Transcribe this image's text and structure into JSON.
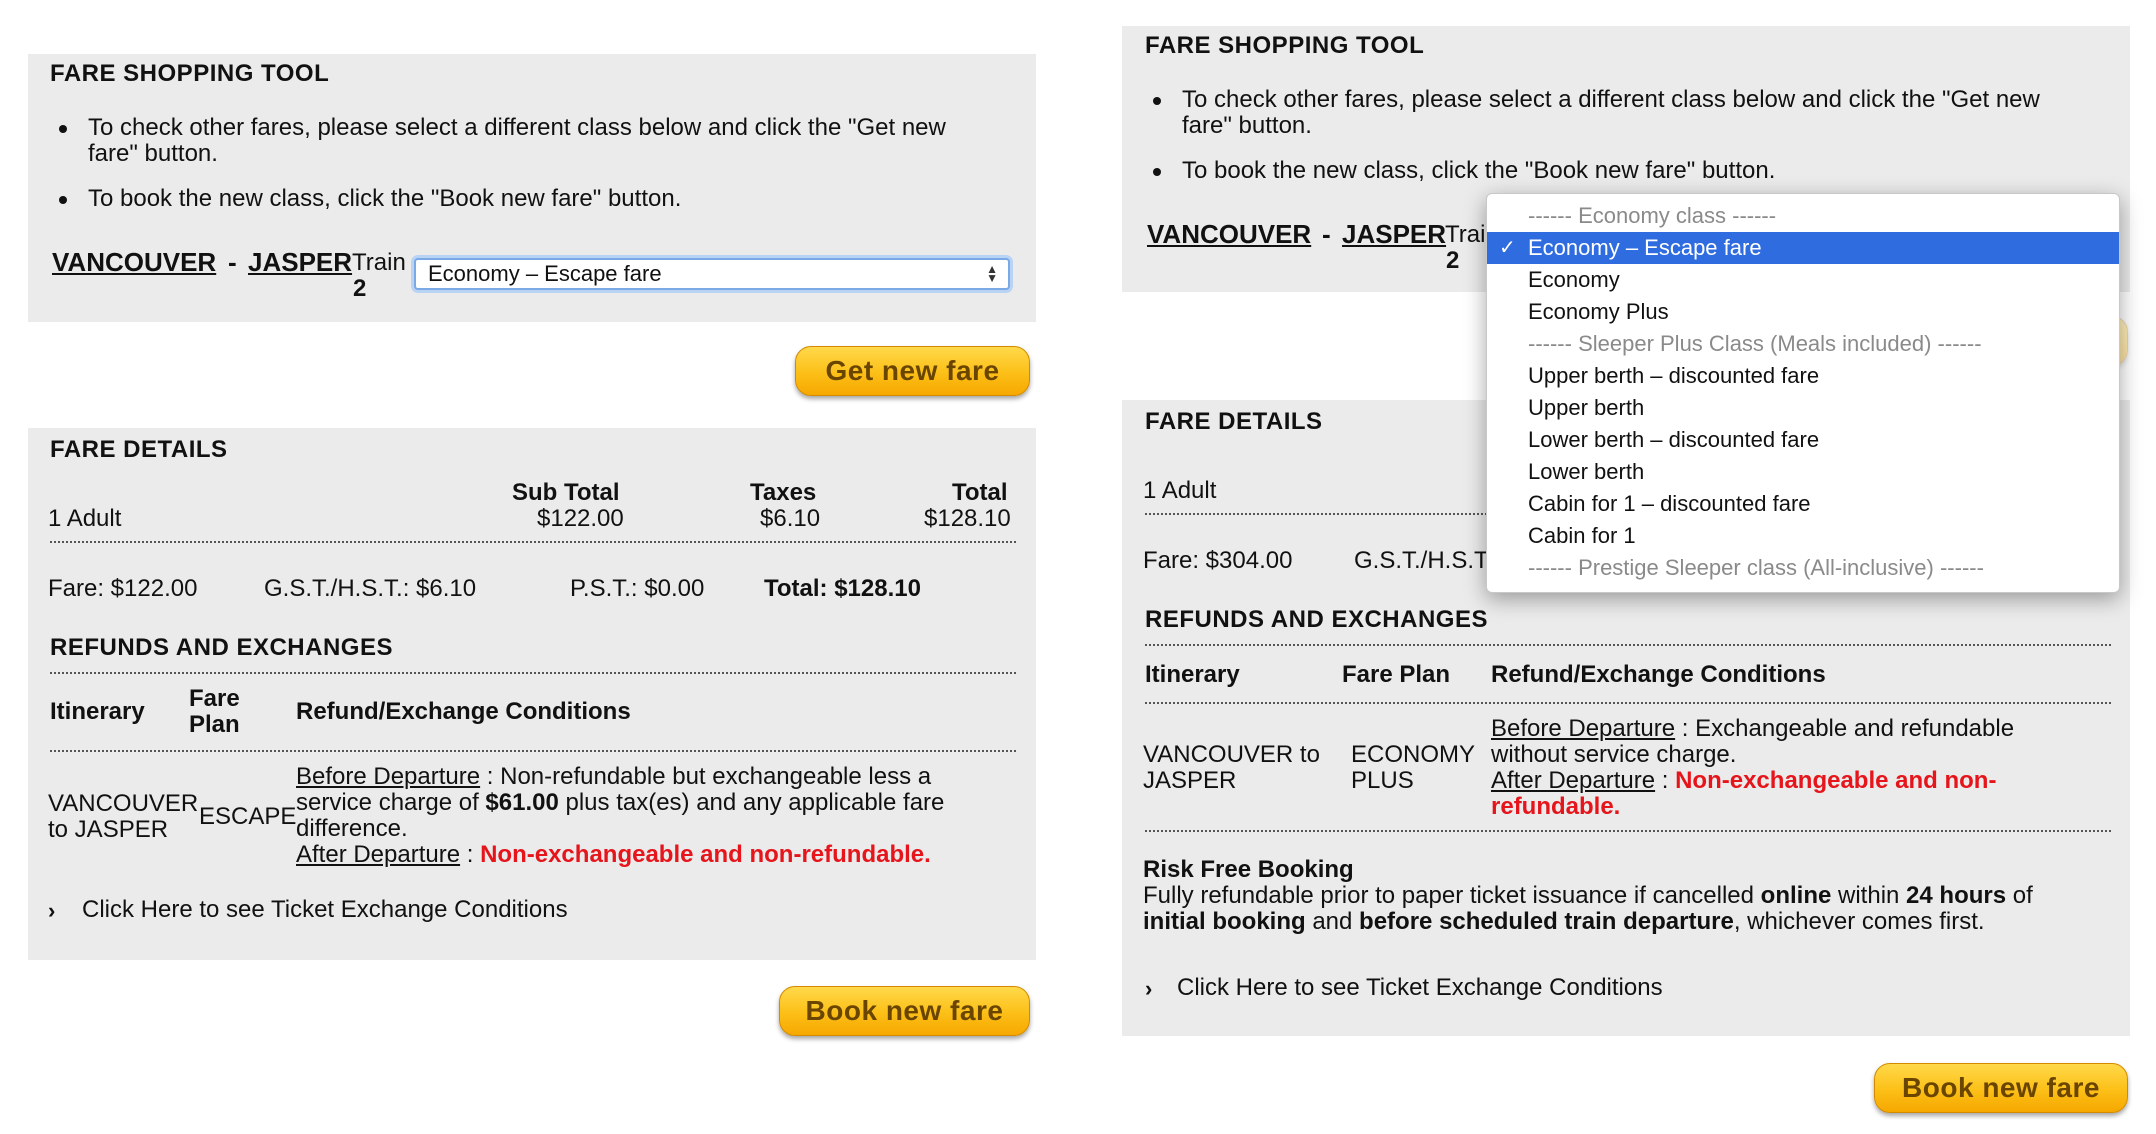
{
  "left": {
    "tool": {
      "title": "FARE SHOPPING TOOL",
      "bullet1_line1": "To check other fares, please select a different class below and click the \"Get new",
      "bullet1_line2": "fare\" button.",
      "bullet2": "To book the new class, click the \"Book new fare\" button.",
      "origin": "VANCOUVER",
      "sep": "-",
      "destination": "JASPER",
      "train_label": "Train",
      "train_number": "2",
      "select_value": "Economy – Escape fare",
      "get_new_fare": "Get new fare"
    },
    "details": {
      "title": "FARE DETAILS",
      "passengers": "1 Adult",
      "subtotal_label": "Sub Total",
      "subtotal_value": "$122.00",
      "taxes_label": "Taxes",
      "taxes_value": "$6.10",
      "total_label": "Total",
      "total_value": "$128.10",
      "fare": "Fare: $122.00",
      "gst": "G.S.T./H.S.T.: $6.10",
      "pst": "P.S.T.: $0.00",
      "grand_total": "Total: $128.10"
    },
    "refunds": {
      "title": "REFUNDS AND EXCHANGES",
      "col_itinerary": "Itinerary",
      "col_fare_plan_1": "Fare",
      "col_fare_plan_2": "Plan",
      "col_conditions": "Refund/Exchange Conditions",
      "itinerary_1": "VANCOUVER",
      "itinerary_2": "to JASPER",
      "fare_plan": "ESCAPE",
      "before_label": "Before Departure",
      "before_text_1": " : Non-refundable but exchangeable less a",
      "before_text_2a": "service charge of ",
      "before_amount": "$61.00",
      "before_text_2b": " plus tax(es) and any applicable fare",
      "before_text_3": "difference.",
      "after_label": "After Departure",
      "after_sep": " : ",
      "after_text": "Non-exchangeable and non-refundable.",
      "link": "Click Here to see Ticket Exchange Conditions"
    },
    "book_new_fare": "Book new fare"
  },
  "right": {
    "tool": {
      "title": "FARE SHOPPING TOOL",
      "bullet1_line1": "To check other fares, please select a different class below and click the \"Get new",
      "bullet1_line2": "fare\" button.",
      "bullet2": "To book the new class, click the \"Book new fare\" button.",
      "origin": "VANCOUVER",
      "sep": "-",
      "destination": "JASPER",
      "train_label": "Trai",
      "train_number": "2"
    },
    "dropdown": {
      "options": [
        {
          "label": "------ Economy class ------",
          "group": true
        },
        {
          "label": "Economy – Escape fare",
          "selected": true
        },
        {
          "label": "Economy"
        },
        {
          "label": "Economy Plus"
        },
        {
          "label": "------ Sleeper Plus Class (Meals included) ------",
          "group": true
        },
        {
          "label": "Upper berth – discounted fare"
        },
        {
          "label": "Upper berth"
        },
        {
          "label": "Lower berth – discounted fare"
        },
        {
          "label": "Lower berth"
        },
        {
          "label": "Cabin for 1 – discounted fare"
        },
        {
          "label": "Cabin for 1"
        },
        {
          "label": "------ Prestige Sleeper class (All-inclusive) ------",
          "group": true
        }
      ],
      "check": "✓"
    },
    "details": {
      "title": "FARE DETAILS",
      "passengers": "1 Adult",
      "fare": "Fare: $304.00",
      "gst_partial": "G.S.T./H.S.T"
    },
    "refunds": {
      "title": "REFUNDS AND EXCHANGES",
      "col_itinerary": "Itinerary",
      "col_fare_plan": "Fare Plan",
      "col_conditions": "Refund/Exchange Conditions",
      "itinerary_1": "VANCOUVER to",
      "itinerary_2": "JASPER",
      "fare_plan_1": "ECONOMY",
      "fare_plan_2": "PLUS",
      "before_label": "Before Departure",
      "before_text_1": " : Exchangeable and refundable",
      "before_text_2": "without service charge.",
      "after_label": "After Departure",
      "after_sep": " : ",
      "after_text_1": "Non-exchangeable and non-",
      "after_text_2": "refundable.",
      "risk_title": "Risk Free Booking",
      "risk_1a": "Fully refundable prior to paper ticket issuance if cancelled ",
      "risk_1b": "online",
      "risk_1c": " within ",
      "risk_1d": "24 hours",
      "risk_1e": " of",
      "risk_2a": "initial booking",
      "risk_2b": " and ",
      "risk_2c": "before scheduled train departure",
      "risk_2d": ", whichever comes first.",
      "link": "Click Here to see Ticket Exchange Conditions"
    },
    "book_new_fare": "Book new fare"
  }
}
